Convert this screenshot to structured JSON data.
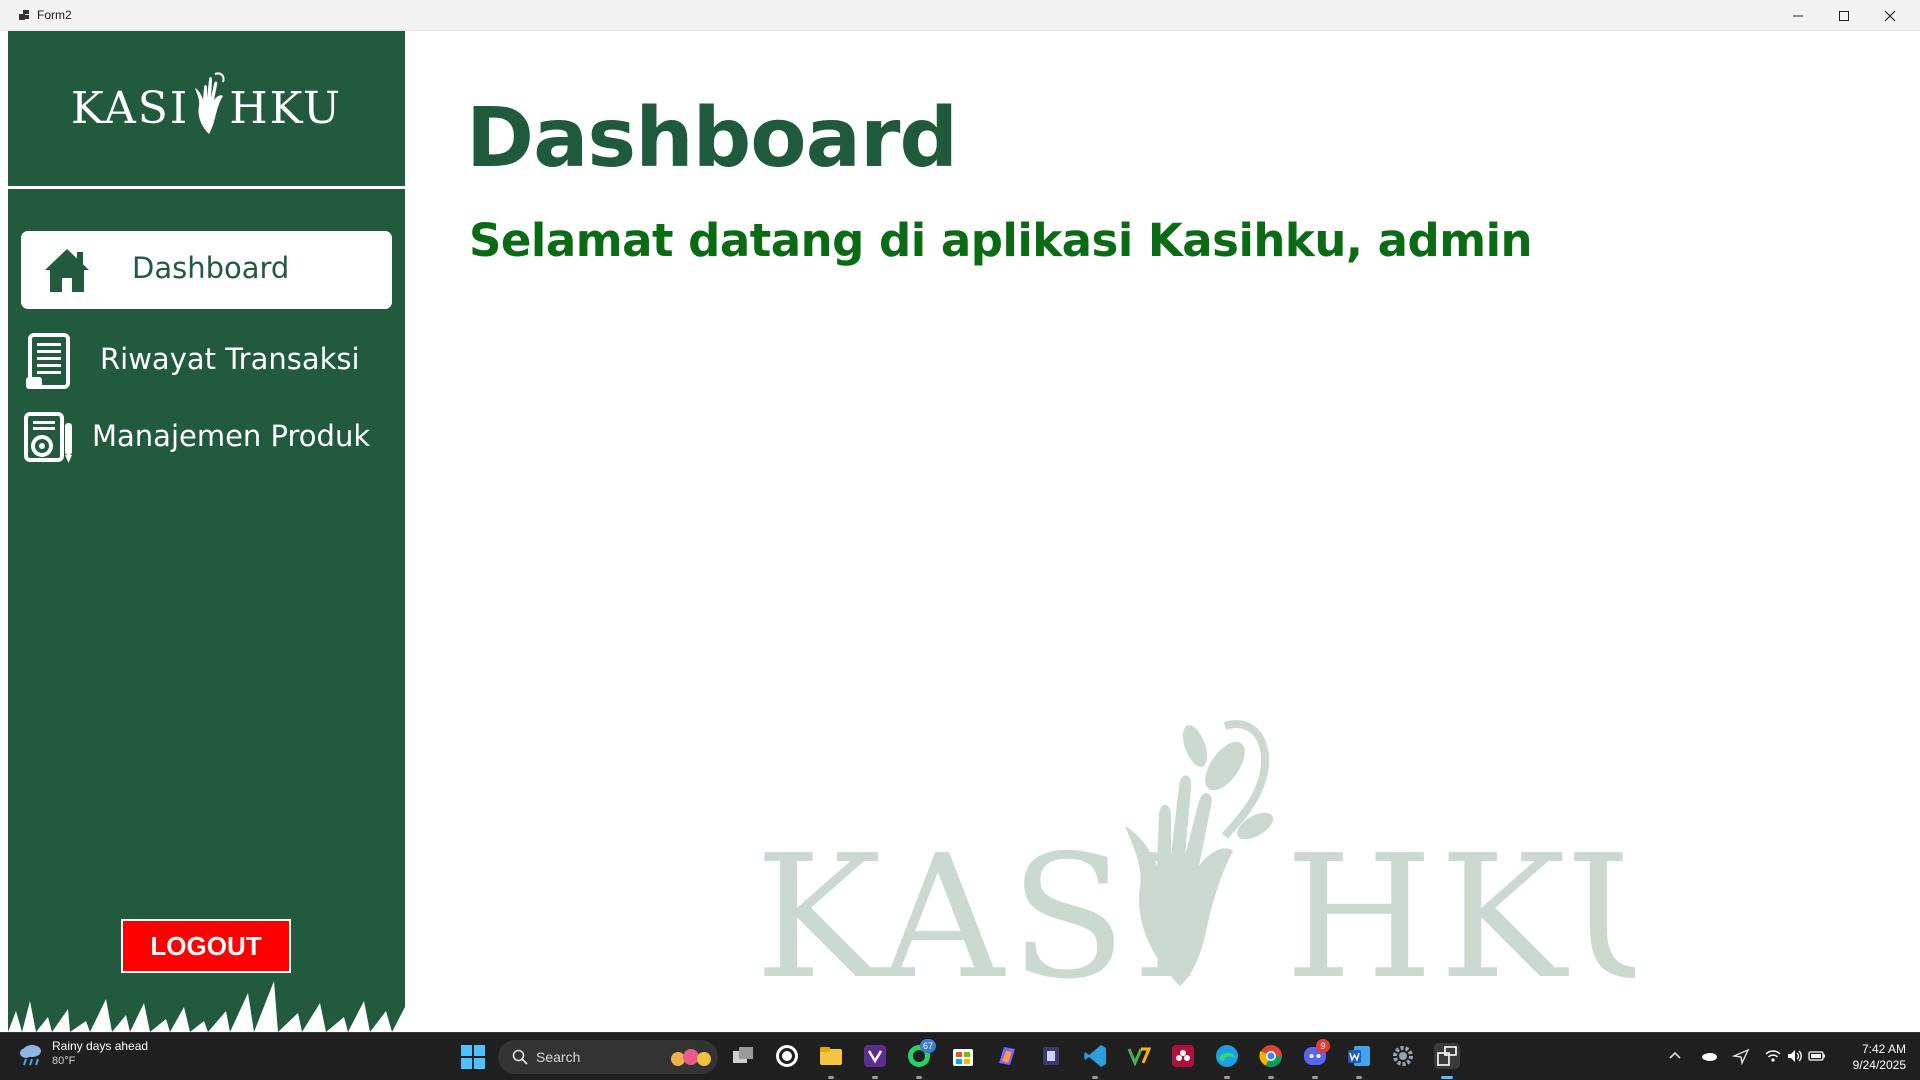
{
  "window": {
    "title": "Form2"
  },
  "sidebar": {
    "logo_left": "KASI",
    "logo_right": "HKU",
    "nav": [
      {
        "label": "Dashboard",
        "active": true,
        "icon": "home-icon"
      },
      {
        "label": "Riwayat Transaksi",
        "active": false,
        "icon": "receipt-icon"
      },
      {
        "label": "Manajemen Produk",
        "active": false,
        "icon": "product-settings-icon"
      }
    ],
    "logout_label": "LOGOUT"
  },
  "main": {
    "title": "Dashboard",
    "welcome": "Selamat datang di aplikasi Kasihku, admin",
    "watermark_left": "KASI",
    "watermark_right": "HKU"
  },
  "taskbar": {
    "weather_line1": "Rainy days ahead",
    "weather_line2": "80°F",
    "search_placeholder": "Search",
    "badges": {
      "whatsapp_beta": "67",
      "discord": "9"
    },
    "time": "7:42 AM",
    "date": "9/24/2025"
  },
  "colors": {
    "sidebar": "#215a3c",
    "title": "#1f5a3c",
    "welcome": "#0b6b14",
    "logout": "#ff0000",
    "watermark": "#cbd9d1"
  }
}
